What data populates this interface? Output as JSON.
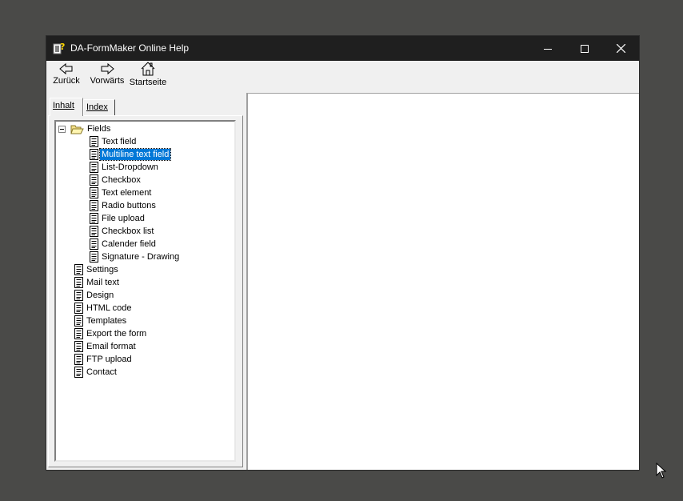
{
  "window": {
    "title": "DA-FormMaker Online Help",
    "controls": [
      "minimize",
      "maximize",
      "close"
    ]
  },
  "toolbar": {
    "back_label": "Zurück",
    "forward_label": "Vorwärts",
    "home_label": "Startseite"
  },
  "tabs": {
    "contents_label": "Inhalt",
    "index_label": "Index",
    "active": "Inhalt"
  },
  "tree": {
    "root": {
      "label": "Fields",
      "expanded": true,
      "icon": "folder-open-icon"
    },
    "children": [
      {
        "label": "Text field",
        "icon": "page-icon"
      },
      {
        "label": "Multiline text field",
        "icon": "page-icon",
        "selected": true
      },
      {
        "label": "List-Dropdown",
        "icon": "page-icon"
      },
      {
        "label": "Checkbox",
        "icon": "page-icon"
      },
      {
        "label": "Text element",
        "icon": "page-icon"
      },
      {
        "label": "Radio buttons",
        "icon": "page-icon"
      },
      {
        "label": "File upload",
        "icon": "page-icon"
      },
      {
        "label": "Checkbox list",
        "icon": "page-icon"
      },
      {
        "label": "Calender field",
        "icon": "page-icon"
      },
      {
        "label": "Signature - Drawing",
        "icon": "page-icon"
      }
    ],
    "topics": [
      {
        "label": "Settings",
        "icon": "page-icon"
      },
      {
        "label": "Mail text",
        "icon": "page-icon"
      },
      {
        "label": "Design",
        "icon": "page-icon"
      },
      {
        "label": "HTML code",
        "icon": "page-icon"
      },
      {
        "label": "Templates",
        "icon": "page-icon"
      },
      {
        "label": "Export the form",
        "icon": "page-icon"
      },
      {
        "label": "Email format",
        "icon": "page-icon"
      },
      {
        "label": "FTP upload",
        "icon": "page-icon"
      },
      {
        "label": "Contact",
        "icon": "page-icon"
      }
    ]
  },
  "colors": {
    "titlebar": "#1f1f1f",
    "selection": "#0078d7",
    "desktop": "#4a4a48"
  }
}
